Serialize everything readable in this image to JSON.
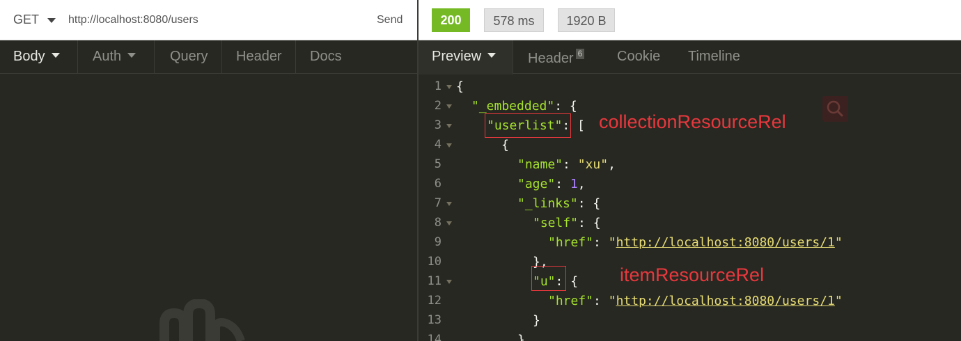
{
  "request": {
    "method": "GET",
    "url": "http://localhost:8080/users",
    "send_label": "Send",
    "tabs": [
      {
        "label": "Body"
      },
      {
        "label": "Auth"
      },
      {
        "label": "Query"
      },
      {
        "label": "Header"
      },
      {
        "label": "Docs"
      }
    ]
  },
  "response": {
    "status": "200",
    "time": "578 ms",
    "size": "1920 B",
    "tabs": [
      {
        "label": "Preview"
      },
      {
        "label": "Header",
        "count": "6"
      },
      {
        "label": "Cookie"
      },
      {
        "label": "Timeline"
      }
    ],
    "lines": [
      {
        "num": "1",
        "text": "{"
      },
      {
        "num": "2",
        "key": "\"_embedded\"",
        "rest": ": {"
      },
      {
        "num": "3",
        "key": "\"userlist\"",
        "rest": ": ["
      },
      {
        "num": "4",
        "text": "{"
      },
      {
        "num": "5",
        "key": "\"name\"",
        "sep": ": ",
        "str": "\"xu\"",
        "tail": ","
      },
      {
        "num": "6",
        "key": "\"age\"",
        "sep": ": ",
        "num_val": "1",
        "tail": ","
      },
      {
        "num": "7",
        "key": "\"_links\"",
        "rest": ": {"
      },
      {
        "num": "8",
        "key": "\"self\"",
        "rest": ": {"
      },
      {
        "num": "9",
        "key": "\"href\"",
        "sep": ": ",
        "q1": "\"",
        "link": "http://localhost:8080/users/1",
        "q2": "\""
      },
      {
        "num": "10",
        "text": "},"
      },
      {
        "num": "11",
        "key": "\"u\"",
        "rest": ": {"
      },
      {
        "num": "12",
        "key": "\"href\"",
        "sep": ": ",
        "q1": "\"",
        "link": "http://localhost:8080/users/1",
        "q2": "\""
      },
      {
        "num": "13",
        "text": "}"
      },
      {
        "num": "14",
        "text": "},"
      }
    ]
  },
  "annotations": {
    "collection": "collectionResourceRel",
    "item": "itemResourceRel"
  },
  "colors": {
    "status_ok": "#75ba24",
    "annotation": "#e8383d",
    "json_key": "#a6e22e",
    "json_string": "#e6db74",
    "json_number": "#ae81ff"
  }
}
